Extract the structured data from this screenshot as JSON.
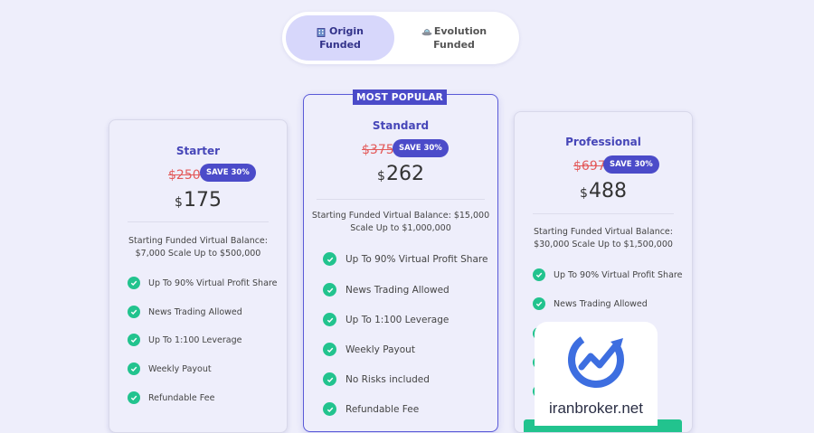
{
  "toggle": {
    "options": [
      {
        "label_line1": "Origin",
        "label_line2": "Funded",
        "icon": "building-icon",
        "active": true
      },
      {
        "label_line1": "Evolution",
        "label_line2": "Funded",
        "icon": "ufo-icon",
        "active": false
      }
    ]
  },
  "plans": [
    {
      "name": "Starter",
      "old_price": "$250",
      "save": "SAVE 30%",
      "currency": "$",
      "price": "175",
      "balance_line1": "Starting Funded Virtual Balance:",
      "balance_line2": "$7,000 Scale Up to $500,000",
      "features": [
        "Up To 90% Virtual Profit Share",
        "News Trading Allowed",
        "Up To 1:100 Leverage",
        "Weekly Payout",
        "Refundable Fee"
      ]
    },
    {
      "name": "Standard",
      "badge": "MOST POPULAR",
      "old_price": "$375",
      "save": "SAVE 30%",
      "currency": "$",
      "price": "262",
      "balance_line1": "Starting Funded Virtual Balance: $15,000",
      "balance_line2": "Scale Up to $1,000,000",
      "features": [
        "Up To 90% Virtual Profit Share",
        "News Trading Allowed",
        "Up To 1:100 Leverage",
        "Weekly Payout",
        "No Risks included",
        "Refundable Fee"
      ]
    },
    {
      "name": "Professional",
      "old_price": "$697",
      "save": "SAVE 30%",
      "currency": "$",
      "price": "488",
      "balance_line1": "Starting Funded Virtual Balance:",
      "balance_line2": "$30,000 Scale Up to $1,500,000",
      "features": [
        "Up To 90% Virtual Profit Share",
        "News Trading Allowed"
      ]
    }
  ],
  "watermark": {
    "text": "iranbroker.net",
    "icon": "growth-chart-logo"
  },
  "colors": {
    "accent": "#4b4bc9",
    "check": "#22c38e",
    "strike": "#e35a5a",
    "background": "#eeeefb"
  }
}
